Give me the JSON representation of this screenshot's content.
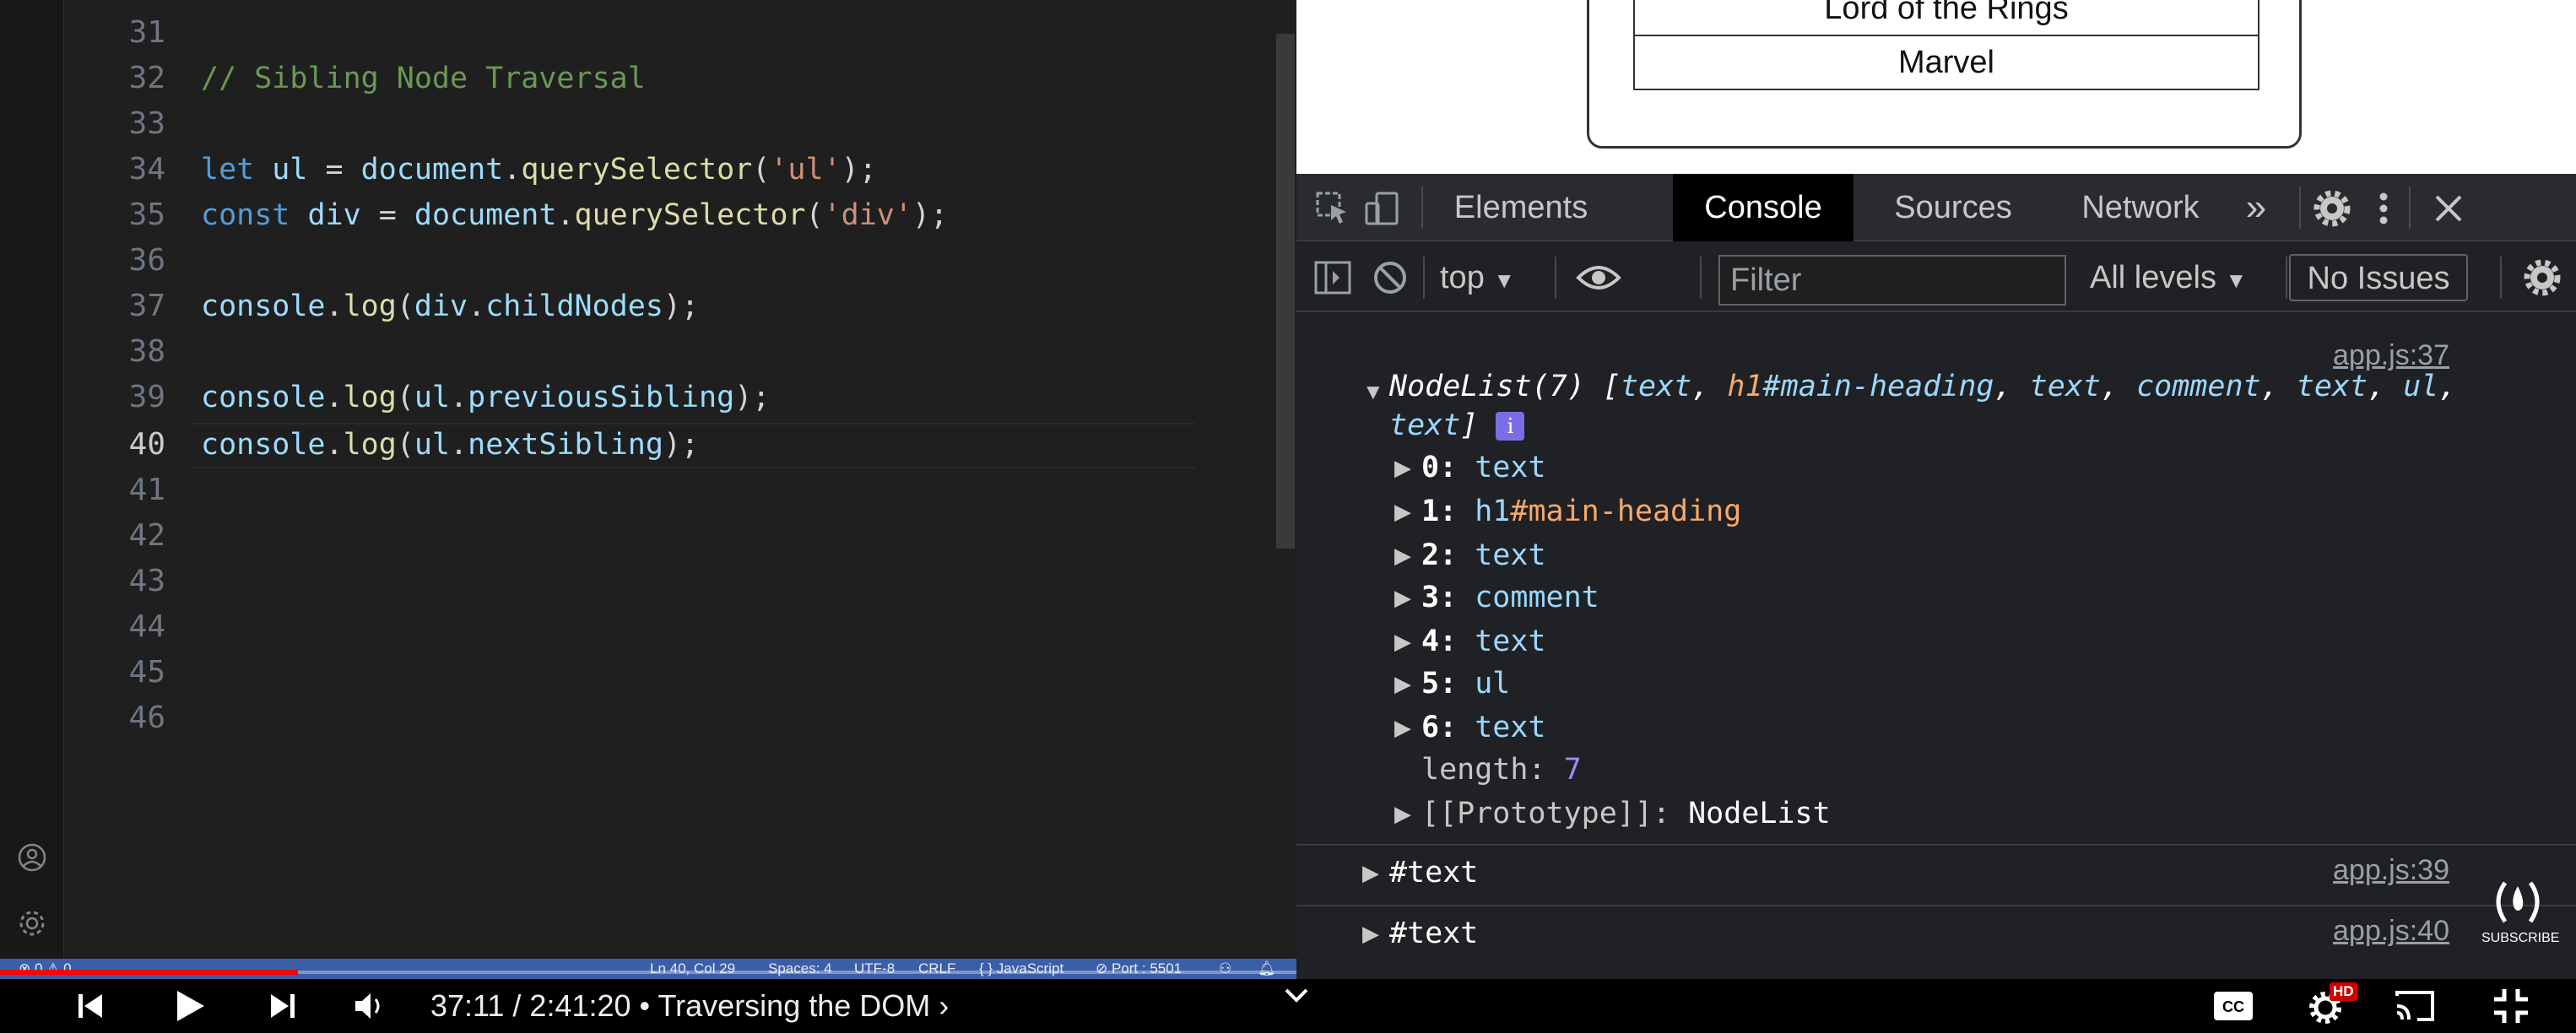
{
  "editor": {
    "line_numbers": [
      "31",
      "32",
      "33",
      "34",
      "35",
      "36",
      "37",
      "38",
      "39",
      "40",
      "41",
      "42",
      "43",
      "44",
      "45",
      "46"
    ],
    "active_line": "40",
    "code": {
      "l32": "// Sibling Node Traversal",
      "l34": {
        "kw": "let",
        "var": "ul",
        "eq": " = ",
        "obj": "document",
        "dot": ".",
        "fn": "querySelector",
        "open": "(",
        "str": "'ul'",
        "close": ");"
      },
      "l35": {
        "kw": "const",
        "var": "div",
        "eq": " = ",
        "obj": "document",
        "dot": ".",
        "fn": "querySelector",
        "open": "(",
        "str": "'div'",
        "close": ");"
      },
      "l37": {
        "obj": "console",
        "dot": ".",
        "fn": "log",
        "open": "(",
        "arg": "div",
        "dot2": ".",
        "prop": "childNodes",
        "close": ");"
      },
      "l39": {
        "obj": "console",
        "dot": ".",
        "fn": "log",
        "open": "(",
        "arg": "ul",
        "dot2": ".",
        "prop": "previousSibling",
        "close": ");"
      },
      "l40": {
        "obj": "console",
        "dot": ".",
        "fn": "log",
        "open": "(",
        "arg": "ul",
        "dot2": ".",
        "prop": "nextSibling",
        "close": ");"
      }
    },
    "status_bar": {
      "problems": "⊗ 0 ⚠ 0",
      "position": "Ln 40, Col 29",
      "spaces": "Spaces: 4",
      "encoding": "UTF-8",
      "eol": "CRLF",
      "language": "{ } JavaScript",
      "port": "⊘ Port : 5501"
    }
  },
  "preview": {
    "items": [
      "Lord of the Rings",
      "Marvel"
    ]
  },
  "devtools": {
    "tabs": [
      "Elements",
      "Console",
      "Sources",
      "Network"
    ],
    "active_tab": "Console",
    "more_tabs": "»",
    "toolbar": {
      "context": "top",
      "filter_placeholder": "Filter",
      "levels": "All levels",
      "issues": "No Issues"
    },
    "console": {
      "message1": {
        "source": "app.js:37",
        "header_prefix": "NodeList(7) [",
        "header_items": [
          "text",
          ", ",
          "h1",
          "#main-heading",
          ", ",
          "text",
          ", ",
          "comment",
          ", ",
          "text",
          ", ",
          "ul",
          ","
        ],
        "header_line2": "text",
        "header_close": "]",
        "info_badge": "i",
        "entries": [
          {
            "key": "0:",
            "val": "text"
          },
          {
            "key": "1:",
            "tag": "h1",
            "id": "#main-heading"
          },
          {
            "key": "2:",
            "val": "text"
          },
          {
            "key": "3:",
            "val": "comment"
          },
          {
            "key": "4:",
            "val": "text"
          },
          {
            "key": "5:",
            "val": "ul"
          },
          {
            "key": "6:",
            "val": "text"
          }
        ],
        "length_key": "length:",
        "length_val": "7",
        "proto_key": "[[Prototype]]:",
        "proto_val": "NodeList"
      },
      "message2": {
        "text": "#text",
        "source": "app.js:39"
      },
      "message3": {
        "text": "#text",
        "source": "app.js:40"
      }
    }
  },
  "video": {
    "time": "37:11 / 2:41:20",
    "chapter": " • Traversing the DOM ›",
    "progress": 0.23,
    "subscribe": "SUBSCRIBE",
    "hd_badge": "HD"
  },
  "colors": {
    "accent": "#3b5ea8",
    "progress_red": "#ff0000"
  }
}
